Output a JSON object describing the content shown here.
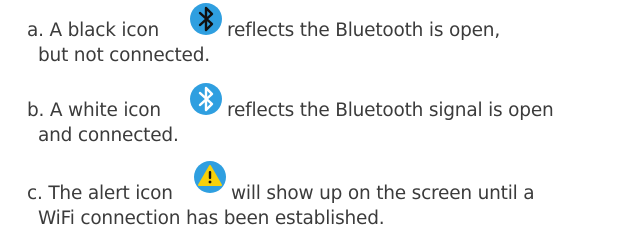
{
  "items": [
    {
      "before": "a. A black icon",
      "after": "reflects the Bluetooth is open,",
      "line2": "but not connected.",
      "icon": "bluetooth-black-icon"
    },
    {
      "before": "b. A white icon",
      "after": "reflects the Bluetooth signal is open",
      "line2": "and connected.",
      "icon": "bluetooth-white-icon"
    },
    {
      "before": "c. The alert icon",
      "after": "will show up on the screen until a",
      "line2": "WiFi connection has been established.",
      "icon": "alert-icon"
    }
  ],
  "colors": {
    "text": "#3b3b3b",
    "icon_blue": "#2f9fe0",
    "alert_yellow": "#f7d10a"
  }
}
